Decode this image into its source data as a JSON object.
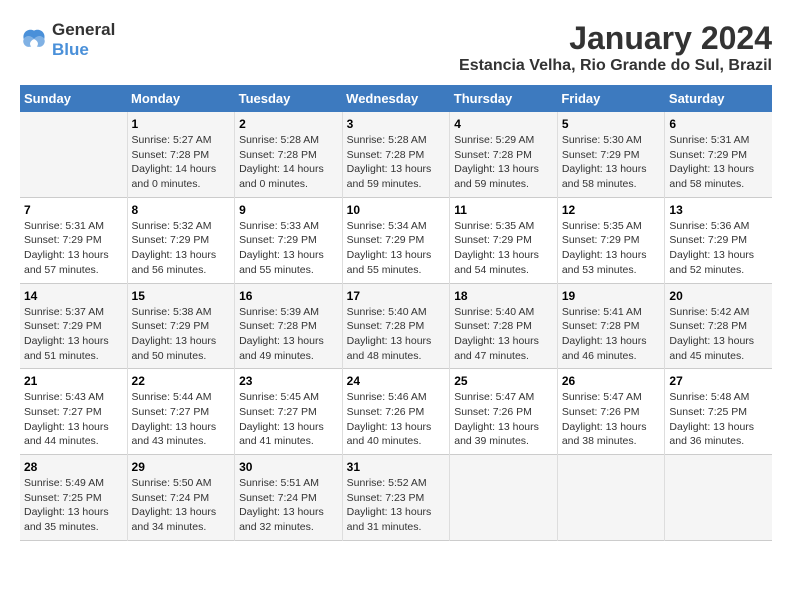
{
  "header": {
    "logo_line1": "General",
    "logo_line2": "Blue",
    "title": "January 2024",
    "subtitle": "Estancia Velha, Rio Grande do Sul, Brazil"
  },
  "weekdays": [
    "Sunday",
    "Monday",
    "Tuesday",
    "Wednesday",
    "Thursday",
    "Friday",
    "Saturday"
  ],
  "weeks": [
    [
      {
        "day": "",
        "info": ""
      },
      {
        "day": "1",
        "info": "Sunrise: 5:27 AM\nSunset: 7:28 PM\nDaylight: 14 hours\nand 0 minutes."
      },
      {
        "day": "2",
        "info": "Sunrise: 5:28 AM\nSunset: 7:28 PM\nDaylight: 14 hours\nand 0 minutes."
      },
      {
        "day": "3",
        "info": "Sunrise: 5:28 AM\nSunset: 7:28 PM\nDaylight: 13 hours\nand 59 minutes."
      },
      {
        "day": "4",
        "info": "Sunrise: 5:29 AM\nSunset: 7:28 PM\nDaylight: 13 hours\nand 59 minutes."
      },
      {
        "day": "5",
        "info": "Sunrise: 5:30 AM\nSunset: 7:29 PM\nDaylight: 13 hours\nand 58 minutes."
      },
      {
        "day": "6",
        "info": "Sunrise: 5:31 AM\nSunset: 7:29 PM\nDaylight: 13 hours\nand 58 minutes."
      }
    ],
    [
      {
        "day": "7",
        "info": "Sunrise: 5:31 AM\nSunset: 7:29 PM\nDaylight: 13 hours\nand 57 minutes."
      },
      {
        "day": "8",
        "info": "Sunrise: 5:32 AM\nSunset: 7:29 PM\nDaylight: 13 hours\nand 56 minutes."
      },
      {
        "day": "9",
        "info": "Sunrise: 5:33 AM\nSunset: 7:29 PM\nDaylight: 13 hours\nand 55 minutes."
      },
      {
        "day": "10",
        "info": "Sunrise: 5:34 AM\nSunset: 7:29 PM\nDaylight: 13 hours\nand 55 minutes."
      },
      {
        "day": "11",
        "info": "Sunrise: 5:35 AM\nSunset: 7:29 PM\nDaylight: 13 hours\nand 54 minutes."
      },
      {
        "day": "12",
        "info": "Sunrise: 5:35 AM\nSunset: 7:29 PM\nDaylight: 13 hours\nand 53 minutes."
      },
      {
        "day": "13",
        "info": "Sunrise: 5:36 AM\nSunset: 7:29 PM\nDaylight: 13 hours\nand 52 minutes."
      }
    ],
    [
      {
        "day": "14",
        "info": "Sunrise: 5:37 AM\nSunset: 7:29 PM\nDaylight: 13 hours\nand 51 minutes."
      },
      {
        "day": "15",
        "info": "Sunrise: 5:38 AM\nSunset: 7:29 PM\nDaylight: 13 hours\nand 50 minutes."
      },
      {
        "day": "16",
        "info": "Sunrise: 5:39 AM\nSunset: 7:28 PM\nDaylight: 13 hours\nand 49 minutes."
      },
      {
        "day": "17",
        "info": "Sunrise: 5:40 AM\nSunset: 7:28 PM\nDaylight: 13 hours\nand 48 minutes."
      },
      {
        "day": "18",
        "info": "Sunrise: 5:40 AM\nSunset: 7:28 PM\nDaylight: 13 hours\nand 47 minutes."
      },
      {
        "day": "19",
        "info": "Sunrise: 5:41 AM\nSunset: 7:28 PM\nDaylight: 13 hours\nand 46 minutes."
      },
      {
        "day": "20",
        "info": "Sunrise: 5:42 AM\nSunset: 7:28 PM\nDaylight: 13 hours\nand 45 minutes."
      }
    ],
    [
      {
        "day": "21",
        "info": "Sunrise: 5:43 AM\nSunset: 7:27 PM\nDaylight: 13 hours\nand 44 minutes."
      },
      {
        "day": "22",
        "info": "Sunrise: 5:44 AM\nSunset: 7:27 PM\nDaylight: 13 hours\nand 43 minutes."
      },
      {
        "day": "23",
        "info": "Sunrise: 5:45 AM\nSunset: 7:27 PM\nDaylight: 13 hours\nand 41 minutes."
      },
      {
        "day": "24",
        "info": "Sunrise: 5:46 AM\nSunset: 7:26 PM\nDaylight: 13 hours\nand 40 minutes."
      },
      {
        "day": "25",
        "info": "Sunrise: 5:47 AM\nSunset: 7:26 PM\nDaylight: 13 hours\nand 39 minutes."
      },
      {
        "day": "26",
        "info": "Sunrise: 5:47 AM\nSunset: 7:26 PM\nDaylight: 13 hours\nand 38 minutes."
      },
      {
        "day": "27",
        "info": "Sunrise: 5:48 AM\nSunset: 7:25 PM\nDaylight: 13 hours\nand 36 minutes."
      }
    ],
    [
      {
        "day": "28",
        "info": "Sunrise: 5:49 AM\nSunset: 7:25 PM\nDaylight: 13 hours\nand 35 minutes."
      },
      {
        "day": "29",
        "info": "Sunrise: 5:50 AM\nSunset: 7:24 PM\nDaylight: 13 hours\nand 34 minutes."
      },
      {
        "day": "30",
        "info": "Sunrise: 5:51 AM\nSunset: 7:24 PM\nDaylight: 13 hours\nand 32 minutes."
      },
      {
        "day": "31",
        "info": "Sunrise: 5:52 AM\nSunset: 7:23 PM\nDaylight: 13 hours\nand 31 minutes."
      },
      {
        "day": "",
        "info": ""
      },
      {
        "day": "",
        "info": ""
      },
      {
        "day": "",
        "info": ""
      }
    ]
  ]
}
